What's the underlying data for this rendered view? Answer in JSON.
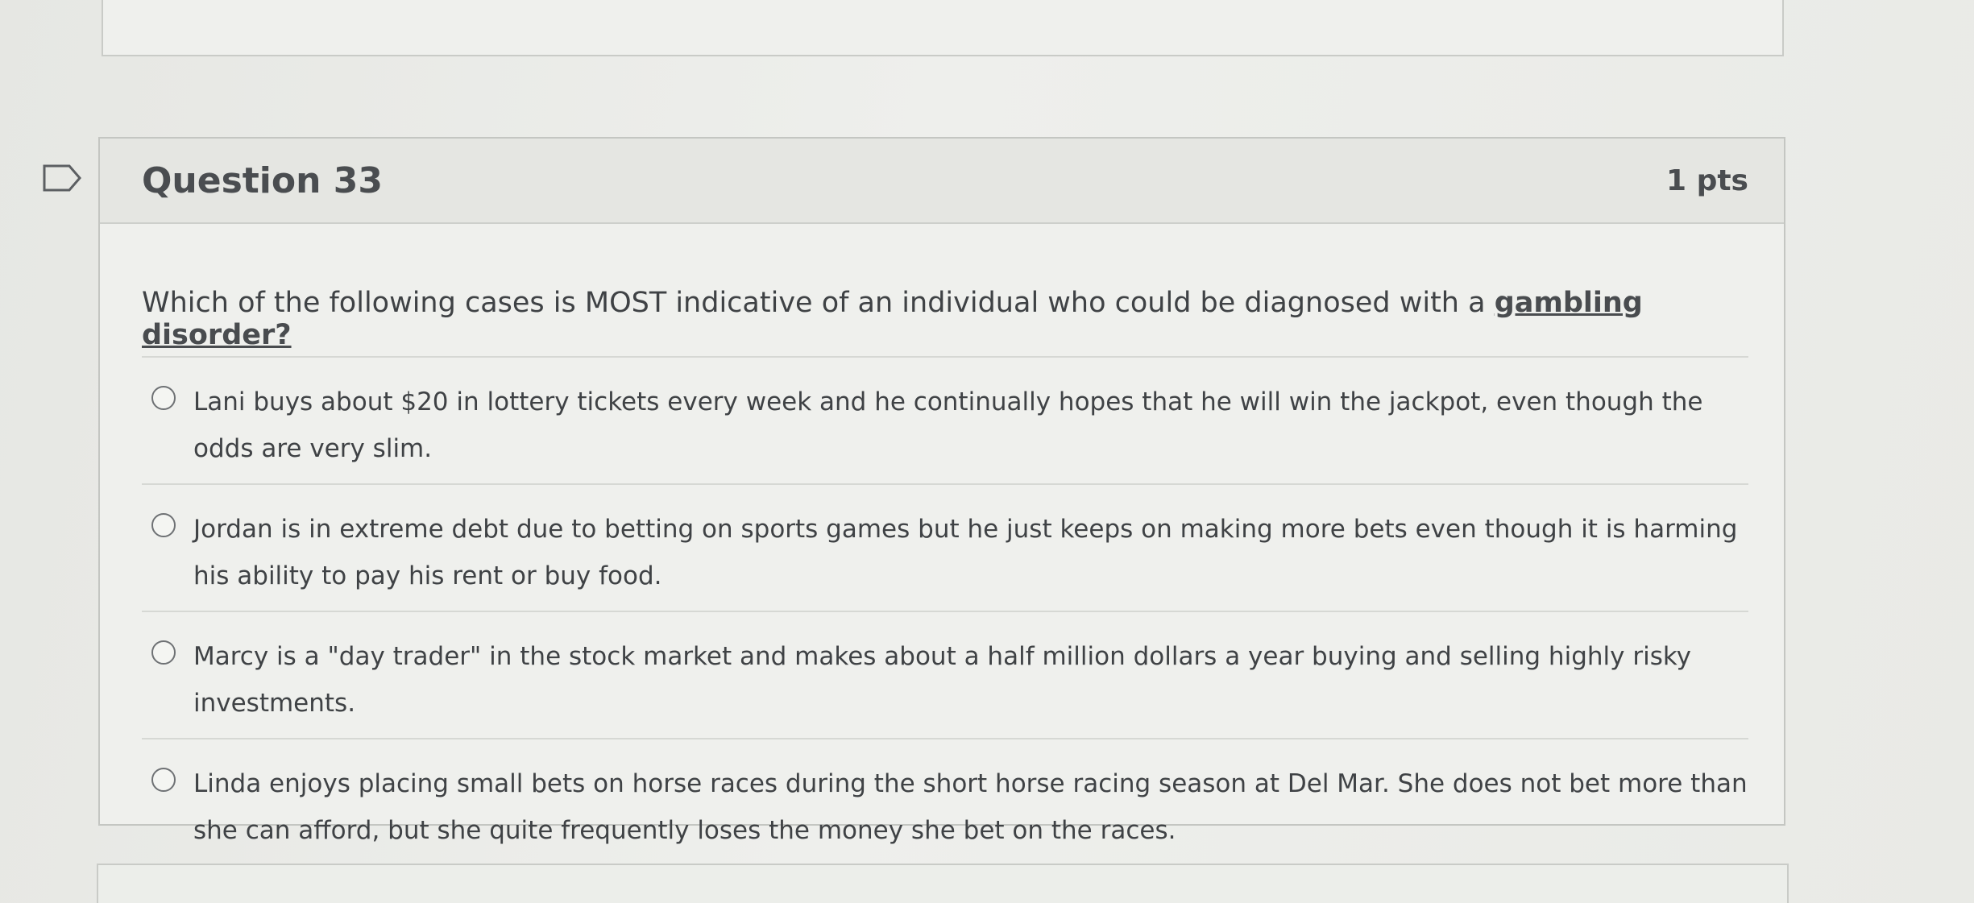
{
  "question": {
    "title": "Question 33",
    "points": "1 pts",
    "text_before": "Which of the following cases is MOST indicative of an individual who could be diagnosed with a ",
    "term": "gambling disorder?",
    "answers": [
      {
        "label": "Lani buys about $20 in lottery tickets every week and he continually hopes that he will win the jackpot, even though the odds are very slim."
      },
      {
        "label": "Jordan is in extreme debt due to betting on sports games but he just keeps on making more bets even though it is harming his ability to pay his rent or buy food."
      },
      {
        "label": "Marcy is a \"day trader\" in the stock market and makes about a half million dollars a year buying and selling highly risky investments."
      },
      {
        "label": "Linda enjoys placing small bets on horse races during the short horse racing season at Del Mar. She does not bet more than she can afford, but she quite frequently loses the money she bet on the races."
      }
    ]
  },
  "icons": {
    "flag": "flag-outline-icon"
  }
}
